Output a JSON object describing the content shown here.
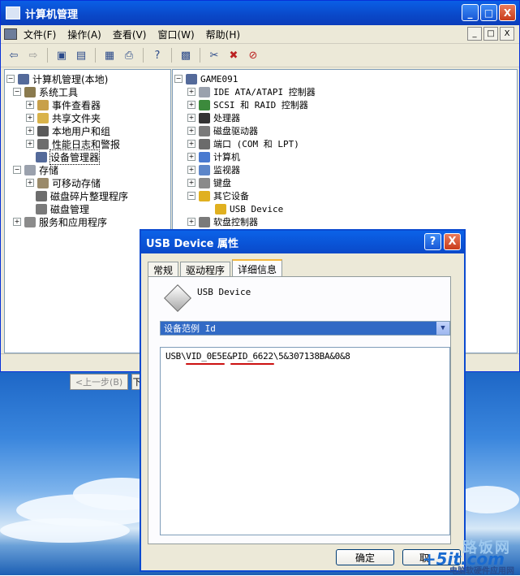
{
  "window": {
    "title": "计算机管理",
    "buttons": [
      "_",
      "□",
      "X"
    ]
  },
  "menu": {
    "items": [
      "文件(F)",
      "操作(A)",
      "查看(V)",
      "窗口(W)",
      "帮助(H)"
    ],
    "mdi_buttons": [
      "_",
      "□",
      "X"
    ]
  },
  "toolbar": {
    "icons": [
      "back-icon",
      "forward-icon",
      "up-folder-icon",
      "show-hide-tree-icon",
      "properties-icon",
      "print-icon",
      "help-icon",
      "scan-icon",
      "uninstall-icon",
      "disable-icon",
      "enable-icon"
    ]
  },
  "left_tree": [
    {
      "label": "计算机管理(本地)",
      "exp": "−"
    },
    {
      "label": "系统工具",
      "exp": "−"
    },
    {
      "label": "事件查看器",
      "exp": "+"
    },
    {
      "label": "共享文件夹",
      "exp": "+"
    },
    {
      "label": "本地用户和组",
      "exp": "+"
    },
    {
      "label": "性能日志和警报",
      "exp": "+"
    },
    {
      "label": "设备管理器",
      "exp": ""
    },
    {
      "label": "存储",
      "exp": "−"
    },
    {
      "label": "可移动存储",
      "exp": "+"
    },
    {
      "label": "磁盘碎片整理程序",
      "exp": ""
    },
    {
      "label": "磁盘管理",
      "exp": ""
    },
    {
      "label": "服务和应用程序",
      "exp": "+"
    }
  ],
  "right_tree": [
    {
      "label": "GAME091",
      "exp": "−"
    },
    {
      "label": "IDE ATA/ATAPI 控制器",
      "exp": "+"
    },
    {
      "label": "SCSI 和 RAID 控制器",
      "exp": "+"
    },
    {
      "label": "处理器",
      "exp": "+"
    },
    {
      "label": "磁盘驱动器",
      "exp": "+"
    },
    {
      "label": "端口 (COM 和 LPT)",
      "exp": "+"
    },
    {
      "label": "计算机",
      "exp": "+"
    },
    {
      "label": "监视器",
      "exp": "+"
    },
    {
      "label": "键盘",
      "exp": "+"
    },
    {
      "label": "其它设备",
      "exp": "−"
    },
    {
      "label": "USB Device",
      "exp": ""
    },
    {
      "label": "软盘控制器",
      "exp": "+"
    }
  ],
  "wizard": {
    "back_label": "<上一步(B)",
    "next_label": "下"
  },
  "dialog": {
    "title": "USB Device 属性",
    "help_label": "?",
    "close_label": "X",
    "tabs": [
      "常规",
      "驱动程序",
      "详细信息"
    ],
    "device_name": "USB Device",
    "property_selected": "设备范例 Id",
    "value": "USB\\VID_0E5E&PID_6622\\5&307138BA&0&8",
    "ok_label": "确定",
    "cancel_label": "取"
  },
  "watermark": {
    "top": "路饭网",
    "mid": "+5it.com",
    "bottom": "电脑软硬件应用网"
  }
}
